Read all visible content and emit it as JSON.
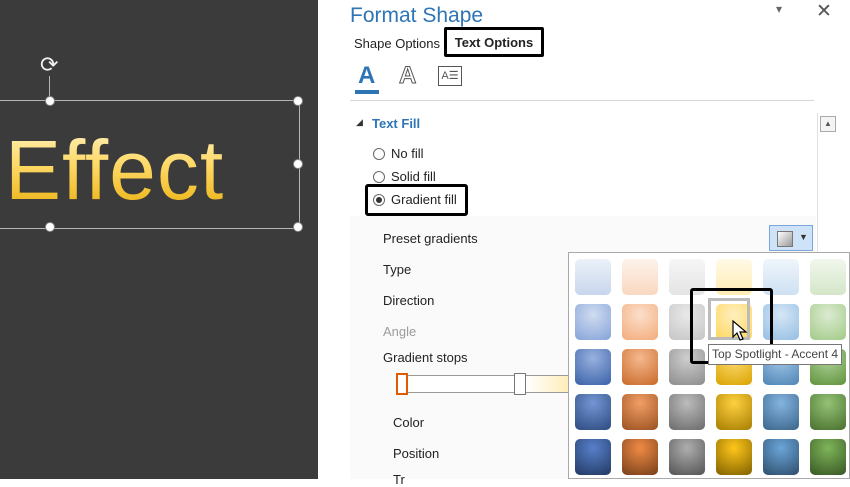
{
  "canvas": {
    "text": "Effect",
    "rotate_glyph": "⟳"
  },
  "pane": {
    "title": "Format Shape",
    "pin_glyph": "▾",
    "close_glyph": "✕",
    "tabs": [
      {
        "label": "Shape Options",
        "selected": false
      },
      {
        "label": "Text Options",
        "selected": true
      }
    ],
    "subtabs": [
      {
        "name": "text-fill-outline",
        "glyph": "A",
        "selected": true
      },
      {
        "name": "text-effects",
        "glyph": "A",
        "selected": false
      },
      {
        "name": "text-box",
        "glyph": "A☰",
        "selected": false
      }
    ],
    "section": {
      "arrow_glyph": "◢",
      "title": "Text Fill"
    },
    "fill_options": [
      {
        "label": "No fill",
        "selected": false
      },
      {
        "label": "Solid fill",
        "selected": false
      },
      {
        "label": "Gradient fill",
        "selected": true
      }
    ],
    "properties": {
      "preset_gradients": "Preset gradients",
      "type": "Type",
      "direction": "Direction",
      "angle": "Angle",
      "gradient_stops": "Gradient stops",
      "color": "Color",
      "position": "Position",
      "transparency": "Tr"
    },
    "preset_caret": "▼",
    "scroll_up_glyph": "▲"
  },
  "gallery": {
    "colors": [
      "#4472c4",
      "#ed7d31",
      "#a5a5a5",
      "#ffc000",
      "#5b9bd5",
      "#70ad47"
    ],
    "rows": 5,
    "hovered": {
      "row": 1,
      "col": 3
    },
    "tooltip": "Top Spotlight - Accent 4"
  },
  "theme": {
    "accent": "#2e75b6",
    "canvas_bg": "#3b3b3b"
  }
}
